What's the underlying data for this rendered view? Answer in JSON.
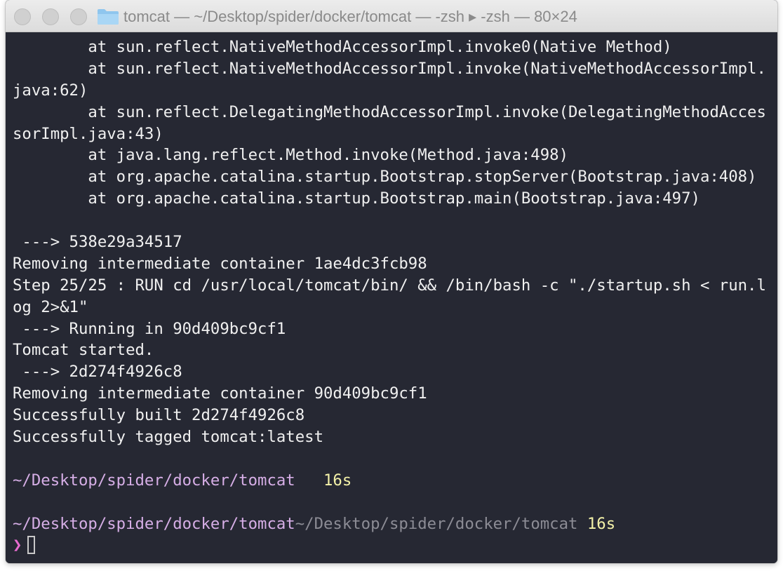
{
  "window": {
    "title": "tomcat — ~/Desktop/spider/docker/tomcat — -zsh ▸ -zsh — 80×24",
    "folder_icon": "folder-icon"
  },
  "colors": {
    "background": "#262833",
    "text": "#f0f0f0",
    "path": "#d6aee6",
    "time": "#f3f1a8",
    "prompt": "#e86bd0"
  },
  "terminal": {
    "lines": [
      "        at sun.reflect.NativeMethodAccessorImpl.invoke0(Native Method)",
      "        at sun.reflect.NativeMethodAccessorImpl.invoke(NativeMethodAccessorImpl.",
      "java:62)",
      "        at sun.reflect.DelegatingMethodAccessorImpl.invoke(DelegatingMethodAcces",
      "sorImpl.java:43)",
      "        at java.lang.reflect.Method.invoke(Method.java:498)",
      "        at org.apache.catalina.startup.Bootstrap.stopServer(Bootstrap.java:408)",
      "        at org.apache.catalina.startup.Bootstrap.main(Bootstrap.java:497)",
      "",
      " ---> 538e29a34517",
      "Removing intermediate container 1ae4dc3fcb98",
      "Step 25/25 : RUN cd /usr/local/tomcat/bin/ && /bin/bash -c \"./startup.sh < run.l",
      "og 2>&1\"",
      " ---> Running in 90d409bc9cf1",
      "Tomcat started.",
      " ---> 2d274f4926c8",
      "Removing intermediate container 90d409bc9cf1",
      "Successfully built 2d274f4926c8",
      "Successfully tagged tomcat:latest",
      ""
    ],
    "prompt1": {
      "path": "~/Desktop/spider/docker/tomcat",
      "spacer": "   ",
      "time": "16s"
    },
    "prompt2": {
      "path": "~/Desktop/spider/docker/tomcat",
      "path_dim": "~/Desktop/spider/docker/tomcat",
      "time": "16s"
    },
    "prompt_symbol": "❯"
  }
}
